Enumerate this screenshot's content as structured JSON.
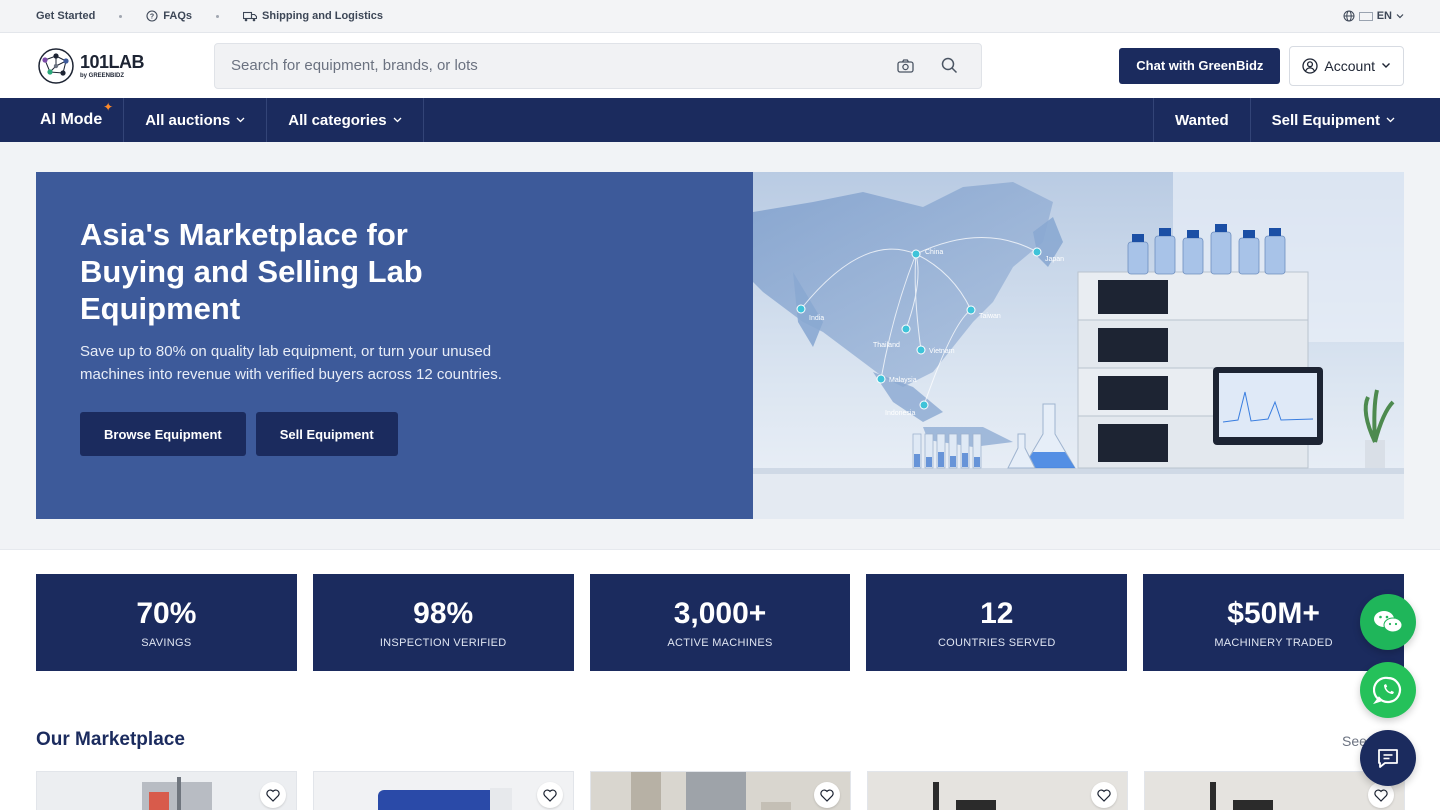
{
  "topbar": {
    "get_started": "Get Started",
    "faqs": "FAQs",
    "shipping": "Shipping and Logistics",
    "language": "EN"
  },
  "header": {
    "logo_main": "101LAB",
    "logo_sub": "by GREENBIDZ",
    "search_placeholder": "Search for equipment, brands, or lots",
    "chat_button": "Chat with GreenBidz",
    "account_button": "Account"
  },
  "nav": {
    "ai_mode": "AI Mode",
    "all_auctions": "All auctions",
    "all_categories": "All categories",
    "wanted": "Wanted",
    "sell_equipment": "Sell Equipment"
  },
  "hero": {
    "title": "Asia's Marketplace for Buying and Selling Lab Equipment",
    "subtitle": "Save up to 80% on quality lab equipment, or turn your unused machines into revenue with verified buyers across 12 countries.",
    "browse_button": "Browse Equipment",
    "sell_button": "Sell Equipment",
    "map_labels": [
      "China",
      "Japan",
      "India",
      "Taiwan",
      "Thailand",
      "Vietnam",
      "Malaysia",
      "Indonesia"
    ]
  },
  "stats": [
    {
      "value": "70%",
      "label": "SAVINGS"
    },
    {
      "value": "98%",
      "label": "INSPECTION VERIFIED"
    },
    {
      "value": "3,000+",
      "label": "ACTIVE MACHINES"
    },
    {
      "value": "12",
      "label": "COUNTRIES SERVED"
    },
    {
      "value": "$50M+",
      "label": "MACHINERY TRADED"
    }
  ],
  "marketplace": {
    "title": "Our Marketplace",
    "see_all": "See"
  },
  "colors": {
    "navy": "#1b2b5e",
    "hero_blue": "#3d5a9a",
    "wechat_green": "#1fb65a",
    "whatsapp_green": "#25c15a",
    "ai_spark": "#ff8a2a"
  },
  "icons": {
    "faq": "question-circle-icon",
    "shipping": "truck-icon",
    "language": "globe-icon",
    "camera": "camera-icon",
    "search": "search-icon",
    "account": "user-circle-icon",
    "favorite": "heart-icon",
    "wechat": "wechat-icon",
    "whatsapp": "whatsapp-icon",
    "support": "chat-bubble-icon"
  }
}
